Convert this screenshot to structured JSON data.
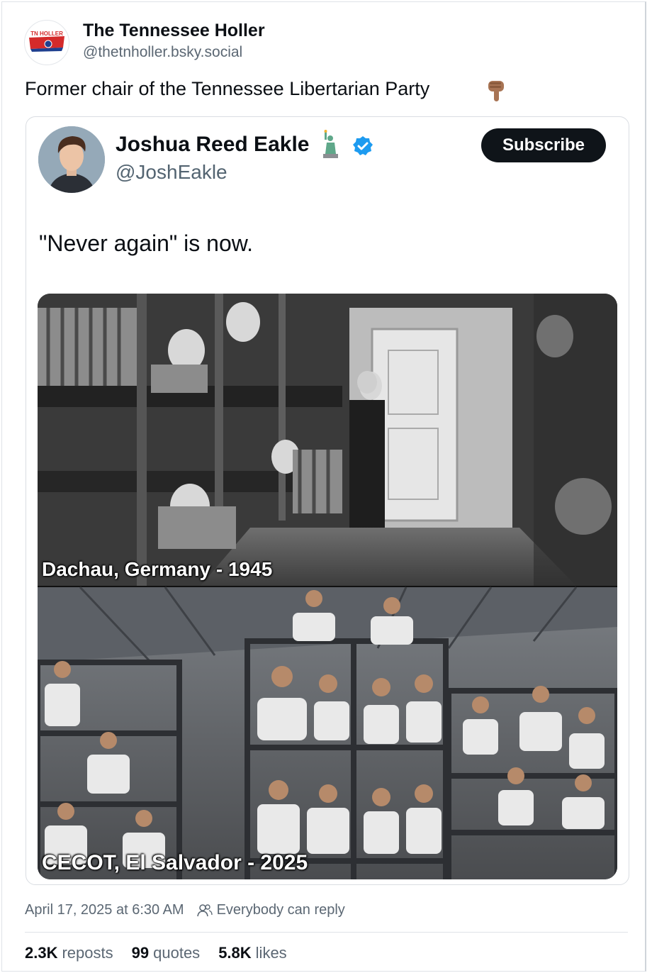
{
  "post": {
    "author_name": "The Tennessee Holler",
    "author_handle": "@thetnholler.bsky.social",
    "avatar_label": "TN HOLLER",
    "text": "Former chair of the Tennessee Libertarian Party",
    "emoji": "pointing-down-icon"
  },
  "quote": {
    "name": "Joshua Reed Eakle",
    "handle": "@JoshEakle",
    "subscribe_label": "Subscribe",
    "text": "\"Never again\" is now.",
    "image": {
      "top_caption": "Dachau, Germany - 1945",
      "bottom_caption": "CECOT, El Salvador - 2025"
    }
  },
  "meta": {
    "timestamp": "April 17, 2025 at 6:30 AM",
    "reply_setting": "Everybody can reply"
  },
  "stats": {
    "reposts_count": "2.3K",
    "reposts_label": "reposts",
    "quotes_count": "99",
    "quotes_label": "quotes",
    "likes_count": "5.8K",
    "likes_label": "likes"
  },
  "colors": {
    "accent": "#1d9bf0",
    "logo_red": "#d42a2a",
    "logo_blue": "#1e3f8f",
    "button": "#0f1419"
  }
}
